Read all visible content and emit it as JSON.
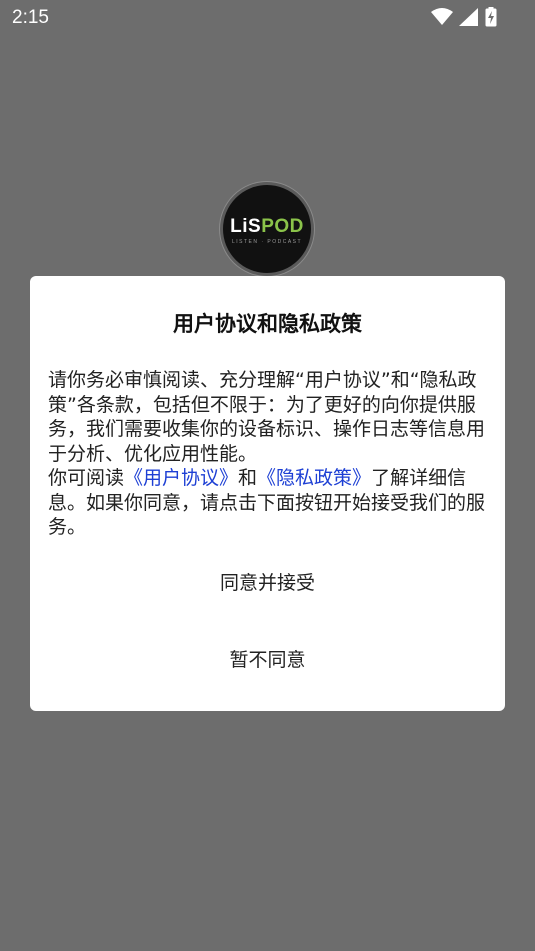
{
  "status_bar": {
    "time": "2:15",
    "icons": [
      "wifi-icon",
      "signal-icon",
      "battery-charging-icon"
    ]
  },
  "logo": {
    "text_main_a": "LiS",
    "text_main_b": "POD",
    "text_sub": "LISTEN · PODCAST",
    "accent_color": "#8bc34a"
  },
  "dialog": {
    "title": "用户协议和隐私政策",
    "paragraph1": "请你务必审慎阅读、充分理解“用户协议”和“隐私政策”各条款，包括但不限于：为了更好的向你提供服务，我们需要收集你的设备标识、操作日志等信息用于分析、优化应用性能。",
    "p2_prefix": "你可阅读",
    "user_agreement_link": "《用户协议》",
    "p2_and": "和",
    "privacy_policy_link": "《隐私政策》",
    "p2_suffix": "了解详细信息。如果你同意，请点击下面按钮开始接受我们的服务。",
    "agree_button": "同意并接受",
    "decline_button": "暂不同意"
  },
  "colors": {
    "overlay": "#6d6d6d",
    "link": "#1d3fd4"
  }
}
